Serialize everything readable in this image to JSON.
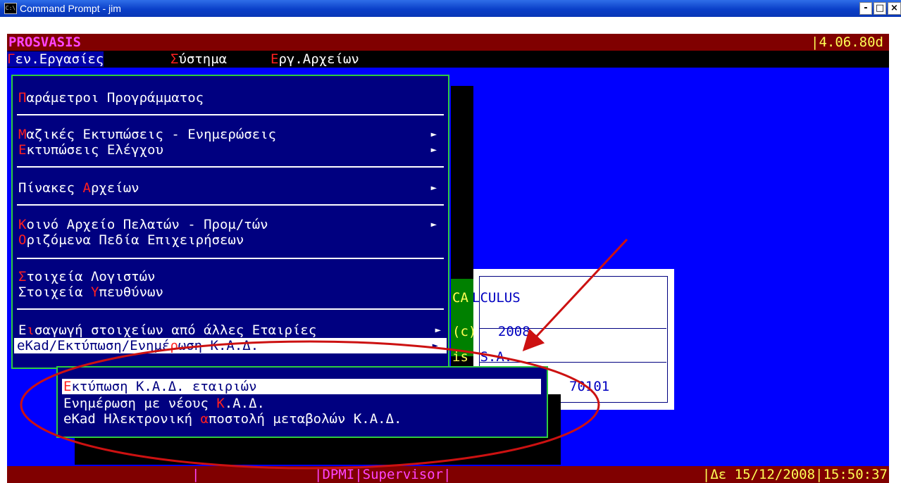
{
  "window": {
    "title": "Command Prompt - jim",
    "icon": "console-icon",
    "controls": {
      "minimize": "-",
      "maximize": "□",
      "close": "×"
    }
  },
  "app": {
    "name": "PROSVASIS",
    "version": "|4.06.80d"
  },
  "menubar": {
    "items": [
      {
        "hotkey": "Γ",
        "rest": "εν.Εργασίες",
        "active": true
      },
      {
        "hotkey": "Σ",
        "rest": "ύστημα",
        "active": false
      },
      {
        "hotkey": "Ε",
        "rest": "ργ.Αρχείων",
        "active": false
      }
    ]
  },
  "dropdown": {
    "items": [
      {
        "hotkey": "Π",
        "rest": "αράμετροι Προγράμματος",
        "submenu": false
      },
      {
        "hotkey": "Μ",
        "rest": "αζικές Εκτυπώσεις - Ενημερώσεις",
        "submenu": true
      },
      {
        "hotkey": "Ε",
        "rest": "κτυπώσεις Ελέγχου",
        "submenu": true
      },
      {
        "pre": "Πίνακες ",
        "hotkey": "Α",
        "rest": "ρχείων",
        "submenu": true
      },
      {
        "hotkey": "Κ",
        "rest": "οινό Αρχείο Πελατών - Προμ/τών",
        "submenu": true
      },
      {
        "hotkey": "Ο",
        "rest": "ριζόμενα Πεδία Επιχειρήσεων",
        "submenu": false
      },
      {
        "hotkey": "Σ",
        "rest": "τοιχεία Λογιστών",
        "submenu": false
      },
      {
        "pre": "Στοιχεία ",
        "hotkey": "Υ",
        "rest": "πευθύνων",
        "submenu": false
      },
      {
        "pre": "Ε",
        "hotkey": "ι",
        "rest": "σαγωγή στοιχείων από άλλες Εταιρίες",
        "submenu": true
      },
      {
        "pre": "eKad/Εκτύπωση/Ενημέ",
        "hotkey": "ρ",
        "rest": "ωση Κ.Α.Δ.",
        "submenu": true,
        "selected": true
      }
    ],
    "arrow": "►"
  },
  "infobox": {
    "left_text": [
      "CA",
      "(c)",
      "is"
    ],
    "lines": [
      "LCULUS",
      "  2008",
      " S.A.",
      "70101"
    ]
  },
  "submenu": {
    "items": [
      {
        "hotkey": "Ε",
        "rest": "κτύπωση Κ.Α.Δ. εταιριών",
        "selected": true
      },
      {
        "pre": "Ενημέρωση με νέους ",
        "hotkey": "Κ",
        "rest": ".Α.Δ."
      },
      {
        "pre": "eKad Ηλεκτρονική ",
        "hotkey": "α",
        "rest": "ποστολή μεταβολών Κ.Α.Δ."
      }
    ]
  },
  "statusbar": {
    "sep1": "|",
    "mode": "|DPMI|Supervisor|",
    "datetime": "|Δε 15/12/2008|15:50:37"
  },
  "colors": {
    "console_bg": "#0000ff",
    "menu_bg": "#000080",
    "title_bar": "#800000",
    "hotkey": "#ff2020",
    "border": "#2ecc40",
    "annotation": "#cc1111"
  }
}
